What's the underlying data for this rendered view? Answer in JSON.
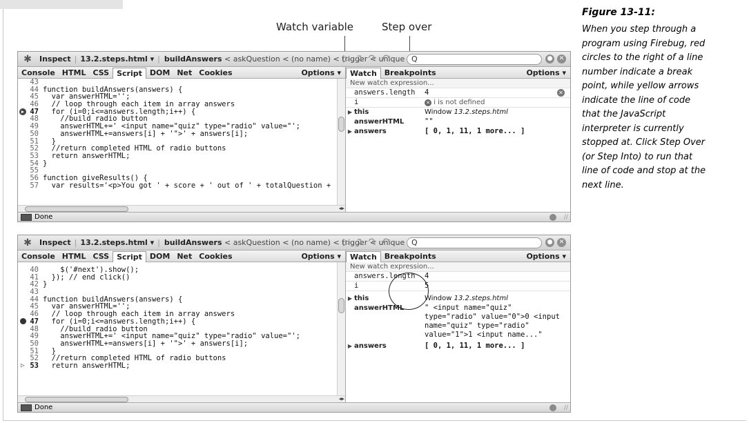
{
  "callouts": {
    "watch_variable": "Watch variable",
    "step_over": "Step over"
  },
  "caption": {
    "title": "Figure 13-11:",
    "body": "When you step through a\nprogram using Firebug, red\ncircles to the right of a line\nnumber indicate a break\npoint, while yellow arrows\nindicate the line of code\nthat the JavaScript\ninterpreter is currently\nstopped at. Click Step Over\n(or Step Into) to run that\nline of code and stop at the\nnext line."
  },
  "toolbar": {
    "inspect": "Inspect",
    "file": "13.2.steps.html ▾",
    "crumb_current": "buildAnswers",
    "crumb_rest": "< askQuestion < (no name) < trigger < unique",
    "search_glyph": "Q"
  },
  "tabs": {
    "left": [
      "Console",
      "HTML",
      "CSS",
      "Script",
      "DOM",
      "Net",
      "Cookies"
    ],
    "right": [
      "Watch",
      "Breakpoints"
    ],
    "options": "Options ▾"
  },
  "status": "Done",
  "watch_common": {
    "new_expression": "New watch expression...",
    "this_name": "this",
    "this_value": "Window",
    "this_file": "13.2.steps.html",
    "answerhtml_name": "answerHTML",
    "answers_name": "answers",
    "answers_value": "[ 0, 1, 11, 1 more... ]",
    "answers_length_name": "answers.length",
    "i_name": "i",
    "answers_length_value": "4"
  },
  "panel1": {
    "watch": {
      "i_value": "i is not defined",
      "answerhtml_value": "\"\""
    },
    "lines": [
      {
        "n": "43",
        "t": "",
        "mark": ""
      },
      {
        "n": "44",
        "t": "function buildAnswers(answers) {",
        "mark": ""
      },
      {
        "n": "45",
        "t": "  var answerHTML='';",
        "mark": ""
      },
      {
        "n": "46",
        "t": "  // loop through each item in array answers",
        "mark": ""
      },
      {
        "n": "47",
        "t": "  for (i=0;i<=answers.length;i++) {",
        "mark": "both"
      },
      {
        "n": "48",
        "t": "    //build radio button",
        "mark": ""
      },
      {
        "n": "49",
        "t": "    answerHTML+=' <input name=\"quiz\" type=\"radio\" value=\"';",
        "mark": ""
      },
      {
        "n": "50",
        "t": "    answerHTML+=answers[i] + '\">' + answers[i];",
        "mark": ""
      },
      {
        "n": "51",
        "t": "  }",
        "mark": ""
      },
      {
        "n": "52",
        "t": "  //return completed HTML of radio buttons",
        "mark": ""
      },
      {
        "n": "53",
        "t": "  return answerHTML;",
        "mark": ""
      },
      {
        "n": "54",
        "t": "}",
        "mark": ""
      },
      {
        "n": "55",
        "t": "",
        "mark": ""
      },
      {
        "n": "56",
        "t": "function giveResults() {",
        "mark": ""
      },
      {
        "n": "57",
        "t": "  var results='<p>You got ' + score + ' out of ' + totalQuestion +",
        "mark": ""
      }
    ]
  },
  "panel2": {
    "watch": {
      "i_value": "5",
      "answerhtml_value": "\" <input name=\"quiz\" type=\"radio\" value=\"0\">0 <input name=\"quiz\" type=\"radio\" value=\"1\">1 <input name...\""
    },
    "lines": [
      {
        "n": "40",
        "t": "    $('#next').show();",
        "mark": ""
      },
      {
        "n": "41",
        "t": "  }); // end click()",
        "mark": ""
      },
      {
        "n": "42",
        "t": "}",
        "mark": ""
      },
      {
        "n": "43",
        "t": "",
        "mark": ""
      },
      {
        "n": "44",
        "t": "function buildAnswers(answers) {",
        "mark": ""
      },
      {
        "n": "45",
        "t": "  var answerHTML='';",
        "mark": ""
      },
      {
        "n": "46",
        "t": "  // loop through each item in array answers",
        "mark": ""
      },
      {
        "n": "47",
        "t": "  for (i=0;i<=answers.length;i++) {",
        "mark": "bp"
      },
      {
        "n": "48",
        "t": "    //build radio button",
        "mark": ""
      },
      {
        "n": "49",
        "t": "    answerHTML+=' <input name=\"quiz\" type=\"radio\" value=\"';",
        "mark": ""
      },
      {
        "n": "50",
        "t": "    answerHTML+=answers[i] + '\">' + answers[i];",
        "mark": ""
      },
      {
        "n": "51",
        "t": "  }",
        "mark": ""
      },
      {
        "n": "52",
        "t": "  //return completed HTML of radio buttons",
        "mark": ""
      },
      {
        "n": "53",
        "t": "  return answerHTML;",
        "mark": "exec"
      }
    ]
  }
}
